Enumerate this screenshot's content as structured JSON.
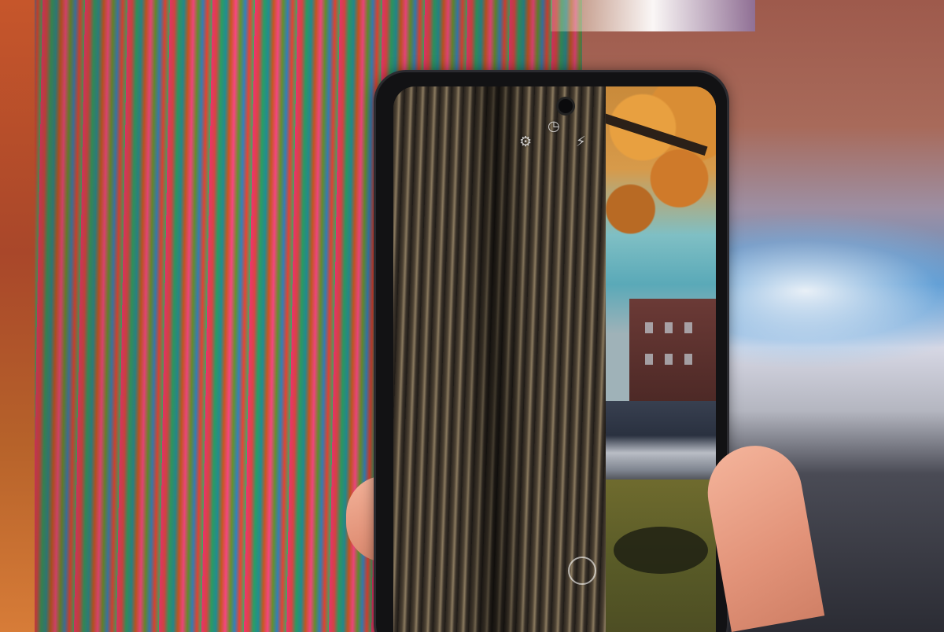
{
  "scene": {
    "phone_screen": {
      "icons": [
        "settings-icon",
        "flash-icon",
        "timer-icon",
        "shutter-icon"
      ]
    }
  }
}
